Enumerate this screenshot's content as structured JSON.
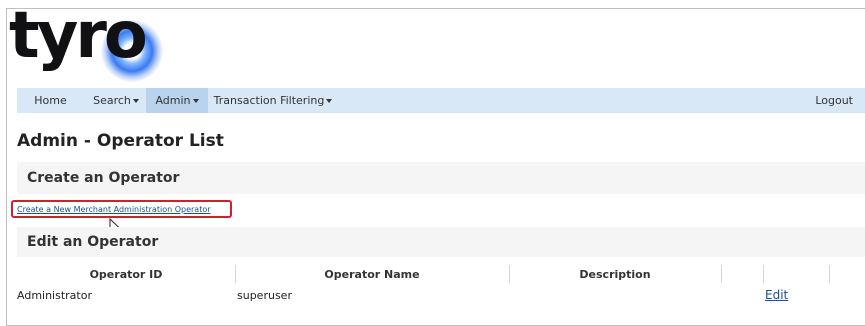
{
  "brand": {
    "logo_text": "tyro"
  },
  "nav": {
    "items": [
      {
        "label": "Home",
        "has_dropdown": false
      },
      {
        "label": "Search",
        "has_dropdown": true
      },
      {
        "label": "Admin",
        "has_dropdown": true,
        "active": true
      },
      {
        "label": "Transaction Filtering",
        "has_dropdown": true
      }
    ],
    "logout_label": "Logout"
  },
  "page": {
    "title": "Admin - Operator List",
    "create_section": {
      "heading": "Create an Operator",
      "link_label": "Create a New Merchant Administration Operator"
    },
    "edit_section": {
      "heading": "Edit an Operator"
    }
  },
  "table": {
    "columns": [
      "Operator ID",
      "Operator Name",
      "Description"
    ],
    "rows": [
      {
        "operator_id": "Administrator",
        "operator_name": "superuser",
        "description": "",
        "action": "Edit"
      }
    ]
  },
  "colors": {
    "nav_bg": "#d9e8f6",
    "nav_active": "#b9d3ee",
    "link": "#1a4f9c",
    "highlight": "#d0202e",
    "section_bg": "#f5f5f5"
  },
  "icons": [
    "mouse-pointer-icon",
    "dropdown-caret-icon"
  ]
}
